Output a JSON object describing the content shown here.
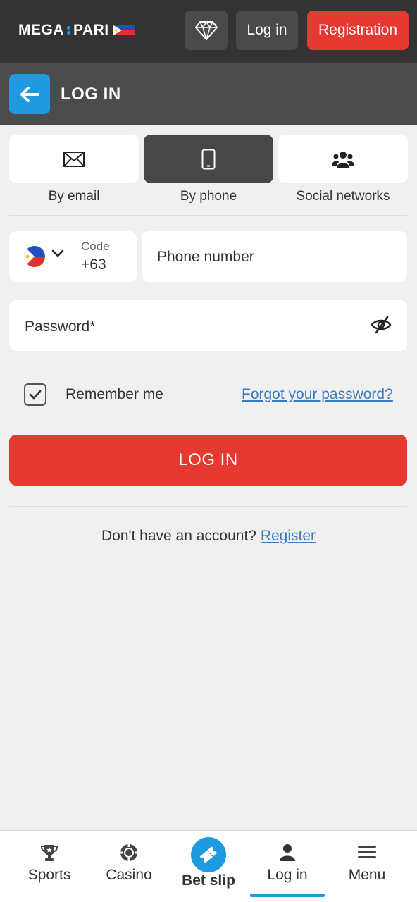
{
  "header": {
    "logo_left": "MEGA",
    "logo_right": "PARI",
    "login_label": "Log in",
    "registration_label": "Registration",
    "brand_color": "#e63932",
    "accent_color": "#1e9ae0"
  },
  "titlebar": {
    "title": "LOG IN"
  },
  "tabs": [
    {
      "label": "By email",
      "icon": "envelope-icon",
      "active": false
    },
    {
      "label": "By phone",
      "icon": "phone-icon",
      "active": true
    },
    {
      "label": "Social networks",
      "icon": "users-icon",
      "active": false
    }
  ],
  "form": {
    "code_label": "Code",
    "code_value": "+63",
    "country_flag": "philippines-flag-icon",
    "phone_placeholder": "Phone number",
    "password_placeholder": "Password*",
    "remember_label": "Remember me",
    "remember_checked": true,
    "forgot_label": "Forgot your password?",
    "submit_label": "LOG IN"
  },
  "signup": {
    "prompt": "Don't have an account?",
    "link": "Register"
  },
  "bottom_nav": {
    "items": [
      {
        "label": "Sports",
        "icon": "trophy-icon"
      },
      {
        "label": "Casino",
        "icon": "casino-chip-icon"
      },
      {
        "label": "Bet slip",
        "icon": "ticket-icon"
      },
      {
        "label": "Log in",
        "icon": "user-icon",
        "active": true
      },
      {
        "label": "Menu",
        "icon": "hamburger-icon"
      }
    ]
  }
}
